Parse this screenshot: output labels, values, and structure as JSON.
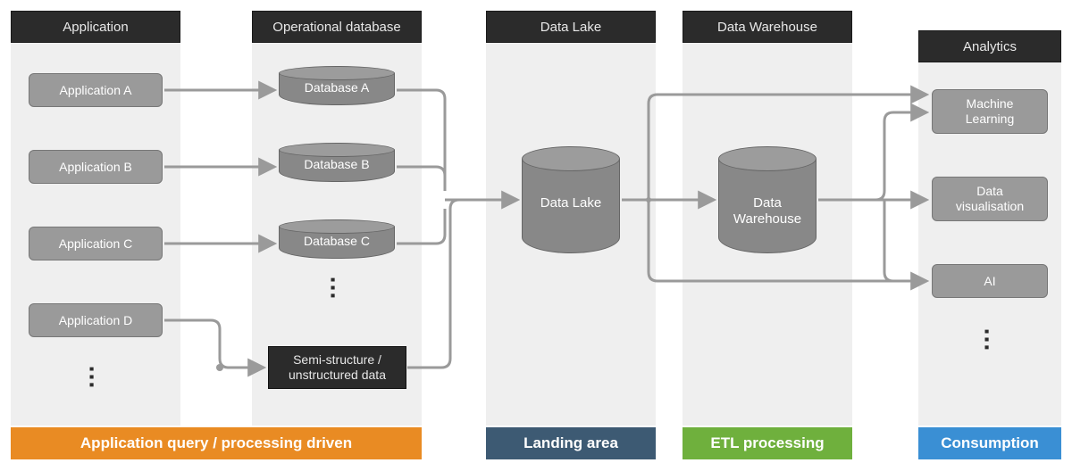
{
  "columns": {
    "application": "Application",
    "operational_db": "Operational database",
    "data_lake": "Data Lake",
    "data_warehouse": "Data Warehouse",
    "analytics": "Analytics"
  },
  "applications": [
    "Application A",
    "Application B",
    "Application C",
    "Application D"
  ],
  "databases": [
    "Database A",
    "Database B",
    "Database C"
  ],
  "semi_structured": "Semi-structure /\nunstructured data",
  "lake_label": "Data Lake",
  "warehouse_label": "Data\nWarehouse",
  "analytics_items": [
    "Machine\nLearning",
    "Data\nvisualisation",
    "AI"
  ],
  "bands": {
    "app_query": "Application query / processing driven",
    "landing": "Landing area",
    "etl": "ETL processing",
    "consumption": "Consumption"
  },
  "colors": {
    "band_orange": "#e98b23",
    "band_blue_dark": "#3d5a73",
    "band_green": "#6fb03d",
    "band_blue": "#3a8fd4"
  }
}
